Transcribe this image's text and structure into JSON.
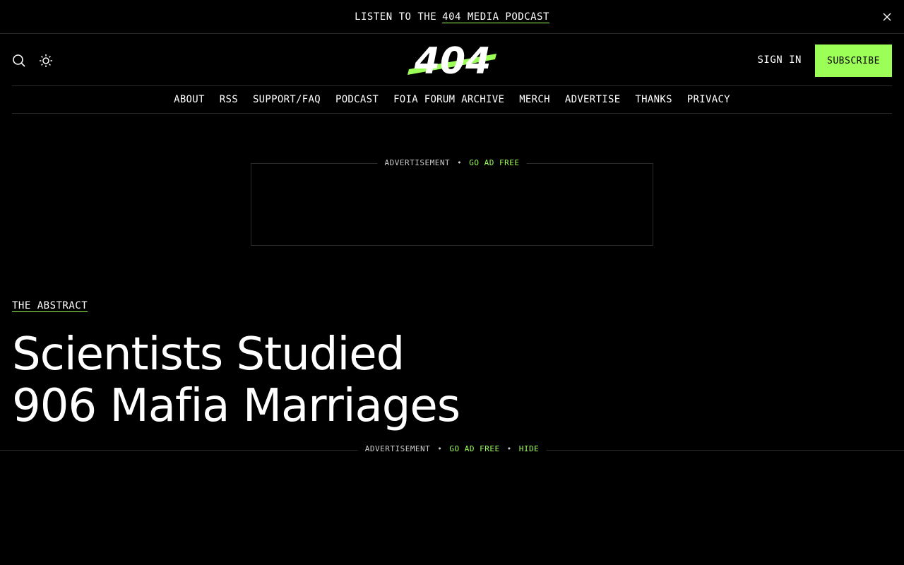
{
  "announcement": {
    "prefix": "LISTEN TO THE",
    "link": "404 MEDIA PODCAST"
  },
  "header": {
    "logo_text": "404",
    "sign_in": "SIGN IN",
    "subscribe": "SUBSCRIBE",
    "accent_color": "#9cff57"
  },
  "nav": {
    "items": [
      "ABOUT",
      "RSS",
      "SUPPORT/FAQ",
      "PODCAST",
      "FOIA FORUM ARCHIVE",
      "MERCH",
      "ADVERTISE",
      "THANKS",
      "PRIVACY"
    ]
  },
  "ad_top": {
    "label": "ADVERTISEMENT",
    "dot": "•",
    "go_ad_free": "GO AD FREE"
  },
  "article": {
    "category": "THE ABSTRACT",
    "headline_line1": "Scientists Studied",
    "headline_line2": "906 Mafia Marriages"
  },
  "ad_bottom": {
    "label": "ADVERTISEMENT",
    "dot": "•",
    "go_ad_free": "GO AD FREE",
    "hide": "HIDE"
  }
}
